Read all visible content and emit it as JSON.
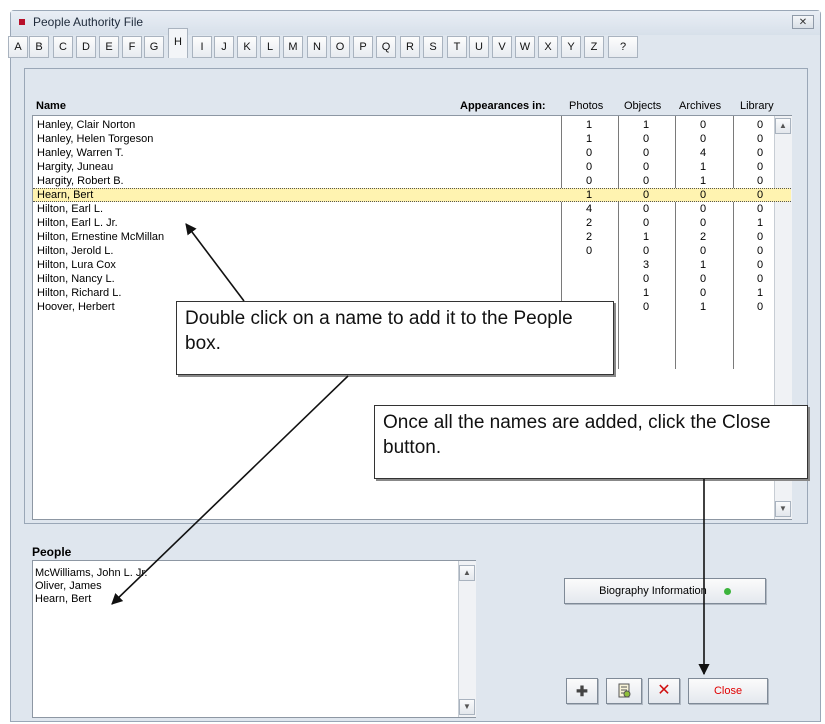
{
  "window": {
    "title": "People Authority File"
  },
  "tabs": [
    "A",
    "B",
    "C",
    "D",
    "E",
    "F",
    "G",
    "H",
    "I",
    "J",
    "K",
    "L",
    "M",
    "N",
    "O",
    "P",
    "Q",
    "R",
    "S",
    "T",
    "U",
    "V",
    "W",
    "X",
    "Y",
    "Z",
    "?"
  ],
  "active_tab": "H",
  "list_header": {
    "name": "Name",
    "appearances": "Appearances in:",
    "photos": "Photos",
    "objects": "Objects",
    "archives": "Archives",
    "library": "Library"
  },
  "rows": [
    {
      "name": "Hanley, Clair Norton",
      "photos": "1",
      "objects": "1",
      "archives": "0",
      "library": "0"
    },
    {
      "name": "Hanley, Helen Torgeson",
      "photos": "1",
      "objects": "0",
      "archives": "0",
      "library": "0"
    },
    {
      "name": "Hanley, Warren T.",
      "photos": "0",
      "objects": "0",
      "archives": "4",
      "library": "0"
    },
    {
      "name": "Hargity, Juneau",
      "photos": "0",
      "objects": "0",
      "archives": "1",
      "library": "0"
    },
    {
      "name": "Hargity, Robert B.",
      "photos": "0",
      "objects": "0",
      "archives": "1",
      "library": "0"
    },
    {
      "name": "Hearn, Bert",
      "photos": "1",
      "objects": "0",
      "archives": "0",
      "library": "0"
    },
    {
      "name": "Hilton, Earl L.",
      "photos": "4",
      "objects": "0",
      "archives": "0",
      "library": "0"
    },
    {
      "name": "Hilton, Earl L. Jr.",
      "photos": "2",
      "objects": "0",
      "archives": "0",
      "library": "1"
    },
    {
      "name": "Hilton, Ernestine McMillan",
      "photos": "2",
      "objects": "1",
      "archives": "2",
      "library": "0"
    },
    {
      "name": "Hilton, Jerold L.",
      "photos": "0",
      "objects": "0",
      "archives": "0",
      "library": "0"
    },
    {
      "name": "Hilton, Lura Cox",
      "photos": "",
      "objects": "3",
      "archives": "1",
      "library": "0"
    },
    {
      "name": "Hilton, Nancy L.",
      "photos": "",
      "objects": "0",
      "archives": "0",
      "library": "0"
    },
    {
      "name": "Hilton, Richard L.",
      "photos": "",
      "objects": "1",
      "archives": "0",
      "library": "1"
    },
    {
      "name": "Hoover, Herbert",
      "photos": "",
      "objects": "0",
      "archives": "1",
      "library": "0"
    }
  ],
  "selected_row": "Hearn, Bert",
  "people": {
    "label": "People",
    "items": [
      "McWilliams, John L. Jr.",
      "Oliver, James",
      "Hearn, Bert"
    ]
  },
  "buttons": {
    "biography": "Biography Information",
    "add_icon": "plus-icon",
    "report_icon": "report-icon",
    "delete_icon": "delete-x-icon",
    "close": "Close"
  },
  "callouts": {
    "double_click": "Double click on a name to add it to the People box.",
    "close_hint": "Once all the names are added, click the Close button."
  },
  "colors": {
    "selected_row": "#fff3b0",
    "close_text": "#e00000",
    "status_dot": "#3cb43c",
    "title_dot": "#b8102a"
  }
}
